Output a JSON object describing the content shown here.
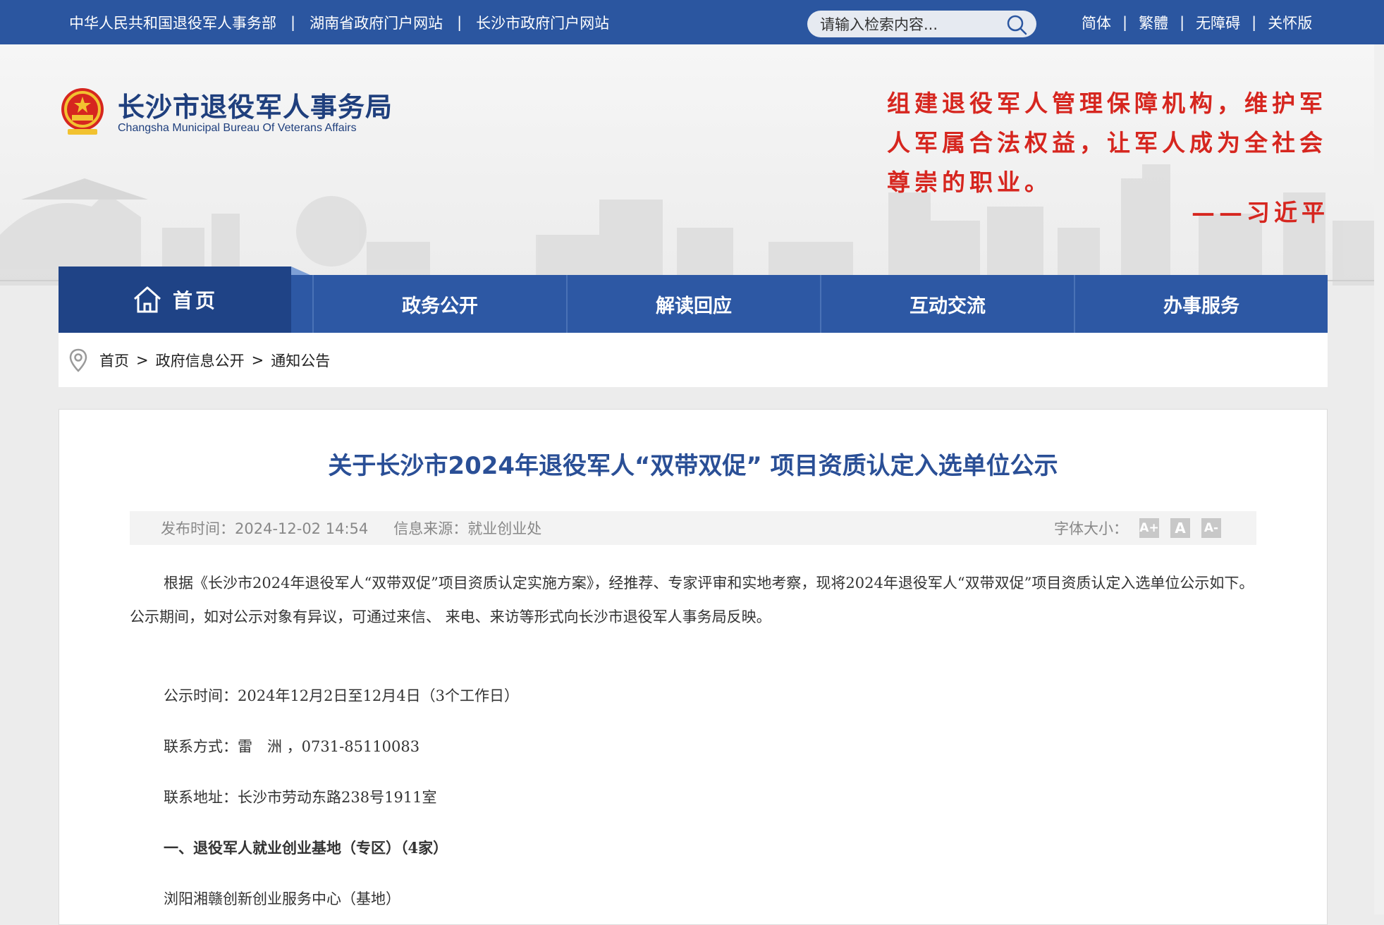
{
  "topbar": {
    "links": [
      "中华人民共和国退役军人事务部",
      "湖南省政府门户网站",
      "长沙市政府门户网站"
    ],
    "search_placeholder": "请输入检索内容...",
    "right_links": [
      "简体",
      "繁體",
      "无障碍",
      "关怀版"
    ]
  },
  "header": {
    "org_name": "长沙市退役军人事务局",
    "org_name_en": "Changsha Municipal Bureau Of Veterans Affairs",
    "quote_lines": [
      "组建退役军人管理保障机构，维护军",
      "人军属合法权益，让军人成为全社会",
      "尊崇的职业。"
    ],
    "quote_author": "——习近平"
  },
  "nav": {
    "home": "首页",
    "items": [
      "政务公开",
      "解读回应",
      "互动交流",
      "办事服务"
    ]
  },
  "breadcrumb": [
    "首页",
    "政府信息公开",
    "通知公告"
  ],
  "article": {
    "title": "关于长沙市2024年退役军人“双带双促” 项目资质认定入选单位公示",
    "publish_time": "发布时间：2024-12-02 14:54",
    "source": "信息来源：就业创业处",
    "font_size_label": "字体大小：",
    "font_buttons": [
      "A+",
      "A",
      "A-"
    ],
    "intro": "根据《长沙市2024年退役军人“双带双促”项目资质认定实施方案》，经推荐、专家评审和实地考察，现将2024年退役军人“双带双促”项目资质认定入选单位公示如下。公示期间，如对公示对象有异议，可通过来信、 来电、来访等形式向长沙市退役军人事务局反映。",
    "notice_period": "公示时间：2024年12月2日至12月4日（3个工作日）",
    "contact": "联系方式：雷　洲 ，0731-85110083",
    "address": "联系地址：长沙市劳动东路238号1911室",
    "section1": "一、退役军人就业创业基地（专区）（4家）",
    "item1": "浏阳湘赣创新创业服务中心（基地）"
  },
  "colors": {
    "topbar": "#2b56a0",
    "nav": "#2d58a4",
    "nav_active": "#1f4386",
    "title": "#2a4f96",
    "quote": "#d6261f"
  }
}
